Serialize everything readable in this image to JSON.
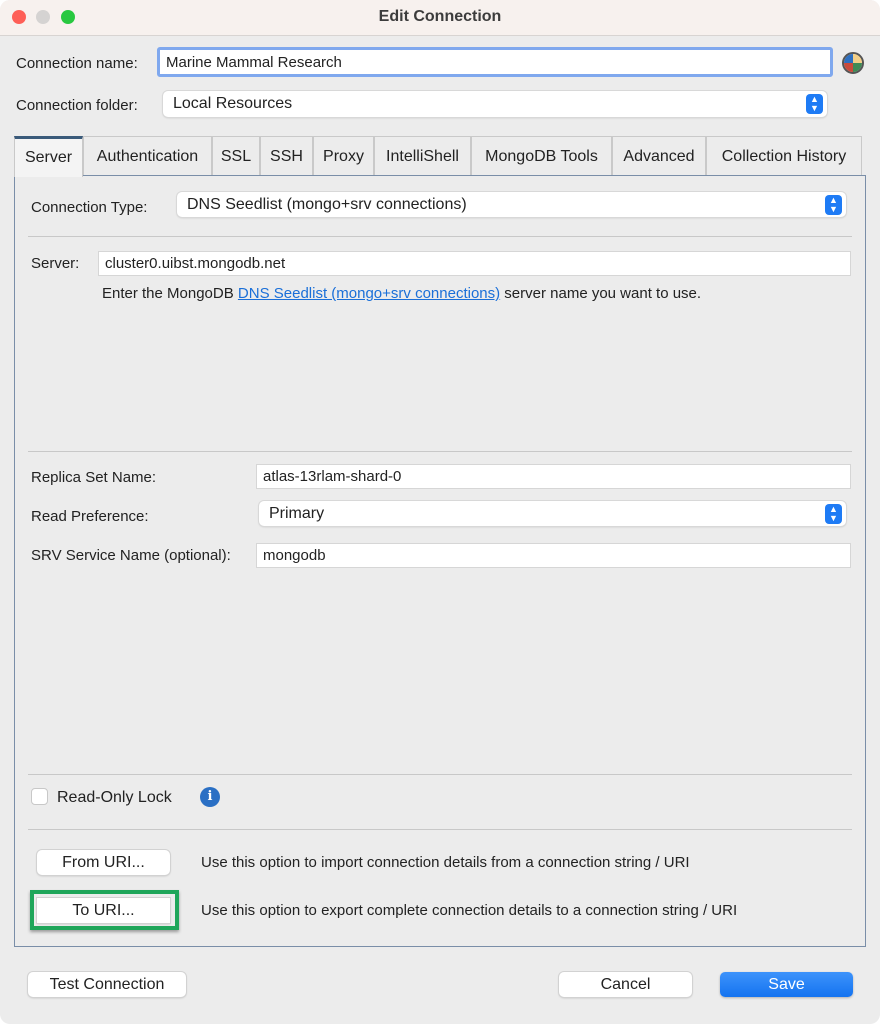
{
  "window": {
    "title": "Edit Connection"
  },
  "form": {
    "connection_name_label": "Connection name:",
    "connection_name_value": "Marine Mammal Research",
    "connection_folder_label": "Connection folder:",
    "connection_folder_value": "Local Resources"
  },
  "tabs": [
    {
      "label": "Server",
      "active": true
    },
    {
      "label": "Authentication"
    },
    {
      "label": "SSL"
    },
    {
      "label": "SSH"
    },
    {
      "label": "Proxy"
    },
    {
      "label": "IntelliShell"
    },
    {
      "label": "MongoDB Tools"
    },
    {
      "label": "Advanced"
    },
    {
      "label": "Collection History"
    }
  ],
  "server": {
    "connection_type_label": "Connection Type:",
    "connection_type_value": "DNS Seedlist (mongo+srv connections)",
    "server_label": "Server:",
    "server_value": "cluster0.uibst.mongodb.net",
    "help_prefix": "Enter the MongoDB ",
    "help_link": "DNS Seedlist (mongo+srv connections)",
    "help_suffix": " server name you want to use.",
    "replica_label": "Replica Set Name:",
    "replica_value": "atlas-13rlam-shard-0",
    "read_pref_label": "Read Preference:",
    "read_pref_value": "Primary",
    "srv_label": "SRV Service Name (optional):",
    "srv_value": "mongodb",
    "readonly_label": "Read-Only Lock",
    "readonly_checked": false,
    "from_uri_label": "From URI...",
    "from_uri_desc": "Use this option to import connection details from a connection string / URI",
    "to_uri_label": "To URI...",
    "to_uri_desc": "Use this option to export complete connection details to a connection string / URI"
  },
  "footer": {
    "test_label": "Test Connection",
    "cancel_label": "Cancel",
    "save_label": "Save"
  },
  "colors": {
    "accent": "#1e7bf5",
    "link": "#1a6fd8",
    "highlight": "#1fa65a"
  }
}
